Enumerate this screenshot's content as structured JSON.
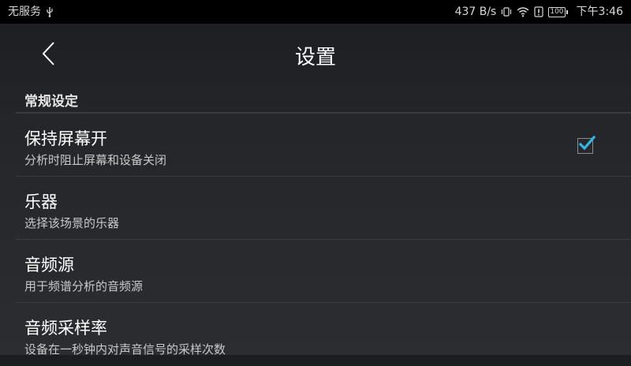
{
  "status_bar": {
    "carrier": "无服务",
    "network_speed": "437 B/s",
    "battery": "100",
    "time": "下午3:46",
    "icons": [
      "usb-icon",
      "vibrate-icon",
      "wifi-icon",
      "alert-icon",
      "battery-icon"
    ]
  },
  "header": {
    "title": "设置",
    "back_icon": "chevron-left-icon"
  },
  "section": {
    "title": "常规设定"
  },
  "settings": [
    {
      "title": "保持屏幕开",
      "subtitle": "分析时阻止屏幕和设备关闭",
      "checked": true
    },
    {
      "title": "乐器",
      "subtitle": "选择该场景的乐器"
    },
    {
      "title": "音频源",
      "subtitle": "用于频谱分析的音频源"
    },
    {
      "title": "音频采样率",
      "subtitle": "设备在一秒钟内对声音信号的采样次数"
    }
  ],
  "colors": {
    "accent": "#33b5e5",
    "status_bar_bg": "#000000",
    "background": "#2b2d31",
    "divider": "#3a3b3f"
  }
}
